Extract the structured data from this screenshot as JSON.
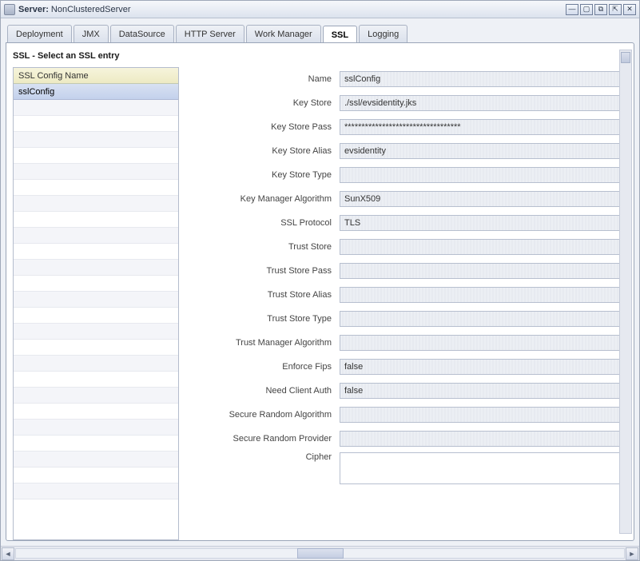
{
  "window": {
    "label": "Server:",
    "name": "NonClusteredServer"
  },
  "tabs": [
    {
      "label": "Deployment"
    },
    {
      "label": "JMX"
    },
    {
      "label": "DataSource"
    },
    {
      "label": "HTTP Server"
    },
    {
      "label": "Work Manager"
    },
    {
      "label": "SSL"
    },
    {
      "label": "Logging"
    }
  ],
  "activeTab": "SSL",
  "sectionTitle": "SSL - Select an SSL entry",
  "list": {
    "header": "SSL Config Name",
    "items": [
      "sslConfig"
    ],
    "selected": "sslConfig"
  },
  "form": [
    {
      "label": "Name",
      "value": "sslConfig"
    },
    {
      "label": "Key Store",
      "value": "./ssl/evsidentity.jks"
    },
    {
      "label": "Key Store Pass",
      "value": "**********************************"
    },
    {
      "label": "Key Store Alias",
      "value": "evsidentity"
    },
    {
      "label": "Key Store Type",
      "value": ""
    },
    {
      "label": "Key Manager Algorithm",
      "value": "SunX509"
    },
    {
      "label": "SSL Protocol",
      "value": "TLS"
    },
    {
      "label": "Trust Store",
      "value": ""
    },
    {
      "label": "Trust Store Pass",
      "value": ""
    },
    {
      "label": "Trust Store Alias",
      "value": ""
    },
    {
      "label": "Trust Store Type",
      "value": ""
    },
    {
      "label": "Trust Manager Algorithm",
      "value": ""
    },
    {
      "label": "Enforce Fips",
      "value": "false"
    },
    {
      "label": "Need Client Auth",
      "value": "false"
    },
    {
      "label": "Secure Random Algorithm",
      "value": ""
    },
    {
      "label": "Secure Random Provider",
      "value": ""
    },
    {
      "label": "Cipher",
      "value": "",
      "multiline": true
    }
  ]
}
